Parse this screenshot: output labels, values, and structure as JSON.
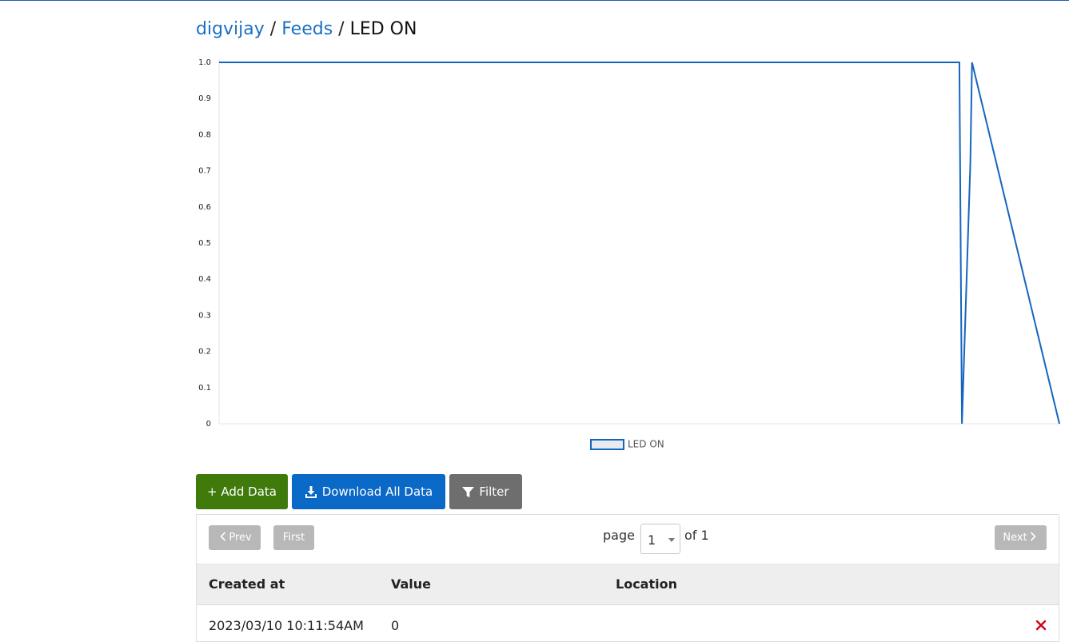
{
  "breadcrumb": {
    "user": "digvijay",
    "separator": "/",
    "feeds": "Feeds",
    "current": "LED ON"
  },
  "chart_data": {
    "type": "line",
    "title": "",
    "xlabel": "",
    "ylabel": "",
    "ylim": [
      0,
      1
    ],
    "y_ticks": [
      "0",
      "0.1",
      "0.2",
      "0.3",
      "0.4",
      "0.5",
      "0.6",
      "0.7",
      "0.8",
      "0.9",
      "1.0"
    ],
    "x_tick_labels": [],
    "grid": false,
    "legend_position": "bottom",
    "series": [
      {
        "name": "LED ON",
        "color": "#1565c0",
        "x": [
          0,
          0.881,
          0.884,
          0.894,
          0.896,
          1.0
        ],
        "values": [
          1,
          1,
          0,
          0.72,
          1,
          0
        ]
      }
    ]
  },
  "toolbar": {
    "add_label": "+ Add Data",
    "download_label": "Download All Data",
    "filter_label": "Filter",
    "download_icon": "download-icon",
    "filter_icon": "filter-icon"
  },
  "pagination": {
    "prev_label": "Prev",
    "first_label": "First",
    "next_label": "Next",
    "page_label": "page",
    "current_page": "1",
    "of_label": "of 1"
  },
  "table": {
    "headers": [
      "Created at",
      "Value",
      "Location"
    ],
    "rows": [
      {
        "created_at": "2023/03/10 10:11:54AM",
        "value": "0",
        "location": ""
      }
    ],
    "delete_icon": "close-icon"
  },
  "colors": {
    "link": "#1a6fc4",
    "add_button": "#3f7a0b",
    "download_button": "#0a68c7",
    "filter_button": "#6e6e6e",
    "pager_button": "#b8b8b8",
    "delete": "#d0021b"
  }
}
